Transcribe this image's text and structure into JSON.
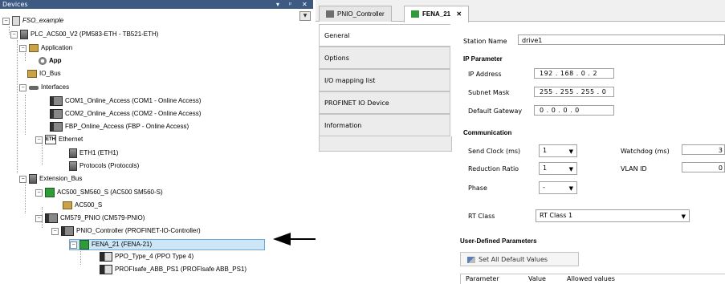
{
  "devices_panel": {
    "title": "Devices",
    "controls": {
      "dropdown": "▾",
      "pin": "ᵖ",
      "close": "✕"
    },
    "tree": [
      {
        "label": "FSO_example",
        "italic": true
      },
      {
        "label": "PLC_AC500_V2 (PM583-ETH - TB521-ETH)"
      },
      {
        "label": "Application"
      },
      {
        "label": "App",
        "bold": true
      },
      {
        "label": "IO_Bus"
      },
      {
        "label": "Interfaces"
      },
      {
        "label": "COM1_Online_Access (COM1 - Online Access)"
      },
      {
        "label": "COM2_Online_Access (COM2 - Online Access)"
      },
      {
        "label": "FBP_Online_Access (FBP - Online Access)"
      },
      {
        "label": "Ethernet"
      },
      {
        "label": "ETH1 (ETH1)"
      },
      {
        "label": "Protocols (Protocols)"
      },
      {
        "label": "Extension_Bus"
      },
      {
        "label": "AC500_SM560_S (AC500 SM560-S)"
      },
      {
        "label": "AC500_S"
      },
      {
        "label": "CM579_PNIO (CM579-PNIO)"
      },
      {
        "label": "PNIO_Controller (PROFINET-IO-Controller)"
      },
      {
        "label": "FENA_21 (FENA-21)",
        "selected": true
      },
      {
        "label": "PPO_Type_4 (PPO Type 4)"
      },
      {
        "label": "PROFIsafe_ABB_PS1 (PROFIsafe ABB_PS1)"
      }
    ]
  },
  "editor": {
    "tabs": [
      {
        "label": "PNIO_Controller"
      },
      {
        "label": "FENA_21",
        "close": "✕",
        "active": true
      }
    ],
    "side_tabs": [
      {
        "label": "General",
        "active": true
      },
      {
        "label": "Options"
      },
      {
        "label": "I/O mapping list"
      },
      {
        "label": "PROFINET IO Device"
      },
      {
        "label": "Information"
      }
    ],
    "general": {
      "station_name_label": "Station Name",
      "station_name_value": "drive1",
      "ip_param_header": "IP Parameter",
      "ip_address_label": "IP Address",
      "ip_address_value": "192 . 168 . 0 . 2",
      "subnet_label": "Subnet Mask",
      "subnet_value": "255 . 255 . 255 . 0",
      "gateway_label": "Default Gateway",
      "gateway_value": "0 . 0 . 0 . 0",
      "communication_header": "Communication",
      "send_clock_label": "Send Clock (ms)",
      "send_clock_value": "1",
      "watchdog_label": "Watchdog (ms)",
      "watchdog_value": "3",
      "reduction_label": "Reduction Ratio",
      "reduction_value": "1",
      "vlan_label": "VLAN ID",
      "vlan_value": "0",
      "phase_label": "Phase",
      "phase_value": "-",
      "rt_class_label": "RT Class",
      "rt_class_value": "RT Class 1",
      "user_params_header": "User-Defined Parameters",
      "set_defaults_label": "Set All Default Values",
      "table_headers": [
        "Parameter",
        "Value",
        "Allowed values"
      ]
    }
  }
}
